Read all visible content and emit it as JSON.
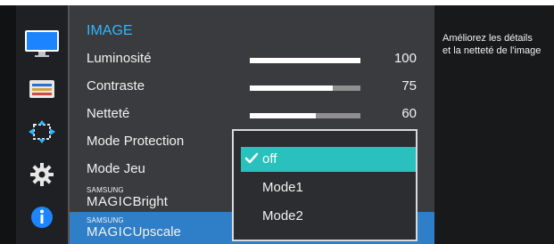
{
  "menu": {
    "title": "IMAGE",
    "rows": [
      {
        "label": "Luminosité",
        "value": "100",
        "level": 1.0
      },
      {
        "label": "Contraste",
        "value": "75",
        "level": 0.75
      },
      {
        "label": "Netteté",
        "value": "60",
        "level": 0.6
      },
      {
        "label": "Mode Protection"
      },
      {
        "label": "Mode Jeu"
      },
      {
        "prefix_small": "SAMSUNG",
        "prefix_big": "MAGIC",
        "label": "Bright"
      },
      {
        "prefix_small": "SAMSUNG",
        "prefix_big": "MAGIC",
        "label": "Upscale"
      }
    ]
  },
  "dropdown": {
    "options": [
      {
        "label": "off",
        "selected": true
      },
      {
        "label": "Mode1",
        "selected": false
      },
      {
        "label": "Mode2",
        "selected": false
      }
    ]
  },
  "description": {
    "line1": "Améliorez les détails",
    "line2": "et la netteté de l'image"
  },
  "sidebar": {
    "icons": [
      "monitor-icon",
      "color-bars-icon",
      "size-position-icon",
      "gear-icon",
      "info-icon"
    ]
  },
  "colors": {
    "title_accent": "#2fb7ff",
    "selected_row": "#2f7ec8",
    "selected_option": "#29c0bd"
  }
}
